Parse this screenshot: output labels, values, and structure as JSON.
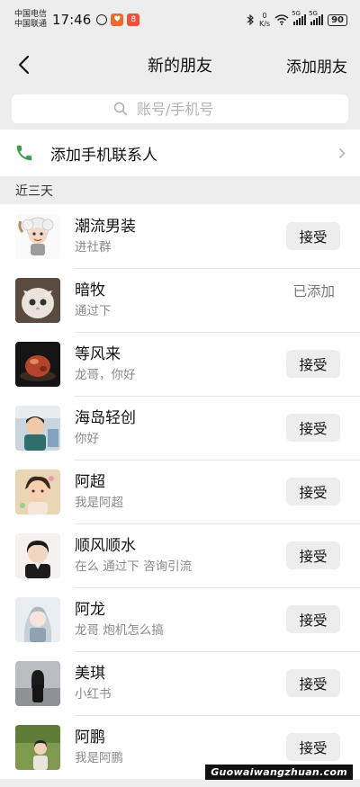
{
  "status_bar": {
    "carrier_1": "中国电信",
    "carrier_2": "中国联通",
    "time": "17:46",
    "net_speed_value": "0",
    "net_speed_unit": "K/s",
    "signal_1_label": "5G",
    "signal_2_label": "5G",
    "battery": "90"
  },
  "nav": {
    "title": "新的朋友",
    "action": "添加朋友"
  },
  "search": {
    "placeholder": "账号/手机号"
  },
  "contacts_row": {
    "label": "添加手机联系人",
    "accent_color": "#3c9c4c"
  },
  "section": {
    "title": "近三天"
  },
  "friends": [
    {
      "name": "潮流男装",
      "message": "进社群",
      "action": "接受",
      "status": ""
    },
    {
      "name": "暗牧",
      "message": "通过下",
      "action": "",
      "status": "已添加"
    },
    {
      "name": "等风来",
      "message": "龙哥，你好",
      "action": "接受",
      "status": ""
    },
    {
      "name": "海岛轻创",
      "message": "你好",
      "action": "接受",
      "status": ""
    },
    {
      "name": "阿超",
      "message": "我是阿超",
      "action": "接受",
      "status": ""
    },
    {
      "name": "顺风顺水",
      "message": "在么 通过下 咨询引流",
      "action": "接受",
      "status": ""
    },
    {
      "name": "阿龙",
      "message": "龙哥 炮机怎么搞",
      "action": "接受",
      "status": ""
    },
    {
      "name": "美琪",
      "message": "小红书",
      "action": "接受",
      "status": ""
    },
    {
      "name": "阿鹏",
      "message": "我是阿鹏",
      "action": "接受",
      "status": ""
    }
  ],
  "watermark": "Guowaiwangzhuan.com"
}
